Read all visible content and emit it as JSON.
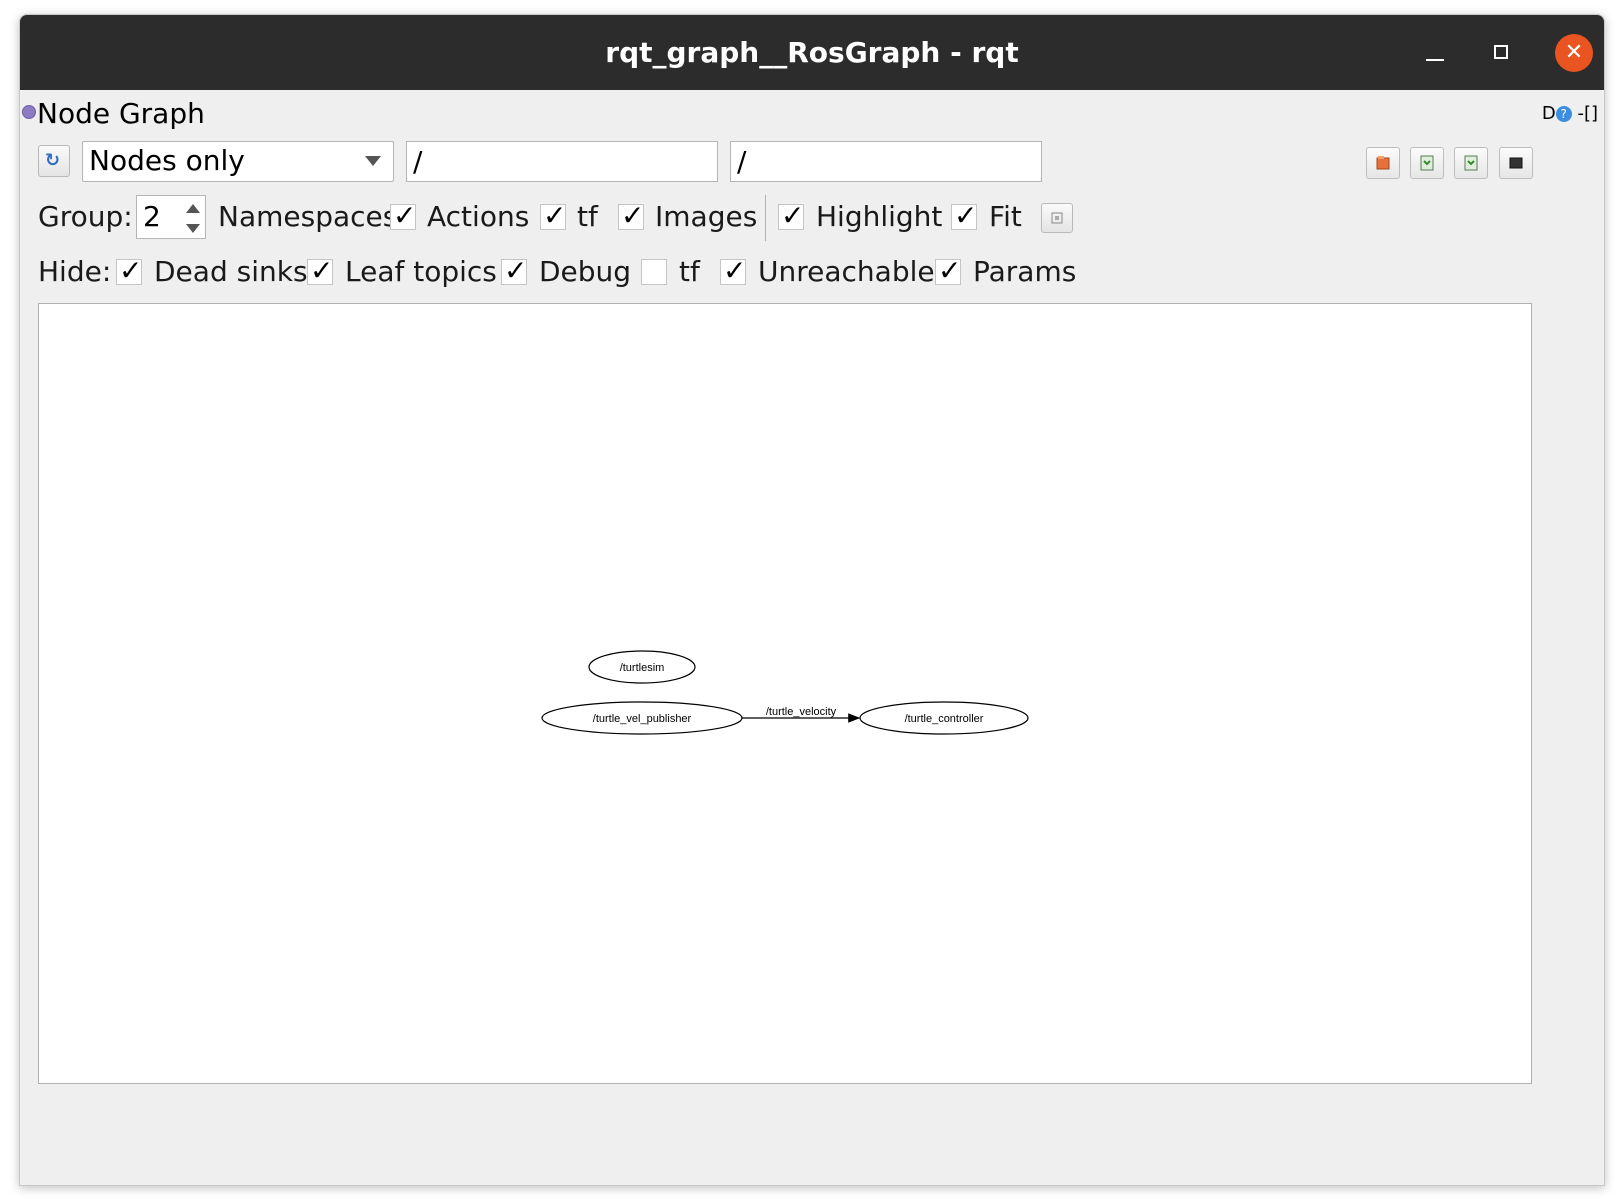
{
  "window": {
    "title": "rqt_graph__RosGraph - rqt"
  },
  "titlebar_buttons": {
    "minimize": "minimize-icon",
    "maximize": "maximize-icon",
    "close": "close-icon",
    "close_color": "#e95420"
  },
  "dock": {
    "title": "Node Graph",
    "right_controls": "D",
    "right_controls2": "-[]"
  },
  "toolbar": {
    "graph_mode": "Nodes only",
    "node_filter": "/",
    "topic_filter": "/"
  },
  "group_row": {
    "group_label": "Group:",
    "group_value": "2",
    "namespaces": {
      "label": "Namespaces",
      "checked": true
    },
    "actions": {
      "label": "Actions",
      "checked": true
    },
    "tf": {
      "label": "tf",
      "checked": true
    },
    "images": {
      "label": "Images",
      "checked": true
    },
    "highlight": {
      "label": "Highlight",
      "checked": true
    },
    "fit": {
      "label": "Fit",
      "checked": true
    }
  },
  "hide_row": {
    "hide_label": "Hide:",
    "dead_sinks": {
      "label": "Dead sinks",
      "checked": true
    },
    "leaf_topics": {
      "label": "Leaf topics",
      "checked": true
    },
    "debug": {
      "label": "Debug",
      "checked": true
    },
    "tf": {
      "label": "tf",
      "checked": false
    },
    "unreachable": {
      "label": "Unreachable",
      "checked": true
    },
    "params": {
      "label": "Params",
      "checked": true
    }
  },
  "graph": {
    "nodes": [
      "/turtlesim",
      "/turtle_vel_publisher",
      "/turtle_controller"
    ],
    "edges": [
      {
        "from": "/turtle_vel_publisher",
        "to": "/turtle_controller",
        "label": "/turtle_velocity"
      }
    ]
  }
}
